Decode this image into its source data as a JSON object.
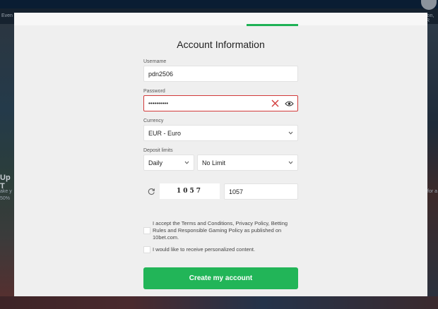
{
  "background": {
    "left_text_1": "Up T",
    "left_text_2": "ake y",
    "left_text_3": "50%",
    "left_top": "Even",
    "right_top": "ion, R",
    "right_mid": "for a"
  },
  "modal": {
    "title": "Account Information",
    "username": {
      "label": "Username",
      "value": "pdn2506"
    },
    "password": {
      "label": "Password",
      "value": "••••••••••"
    },
    "currency": {
      "label": "Currency",
      "value": "EUR - Euro"
    },
    "deposit_limits": {
      "label": "Deposit limits",
      "period": "Daily",
      "amount": "No Limit"
    },
    "captcha": {
      "image_text": "1057",
      "value": "1057"
    },
    "terms_text": "I accept the Terms and Conditions, Privacy Policy, Betting Rules and Responsible Gaming Policy as published on 10bet.com.",
    "personalized_text": "I would like to receive personalized content.",
    "create_button": "Create my account"
  },
  "colors": {
    "accent": "#22b558",
    "error": "#d23a3a"
  }
}
